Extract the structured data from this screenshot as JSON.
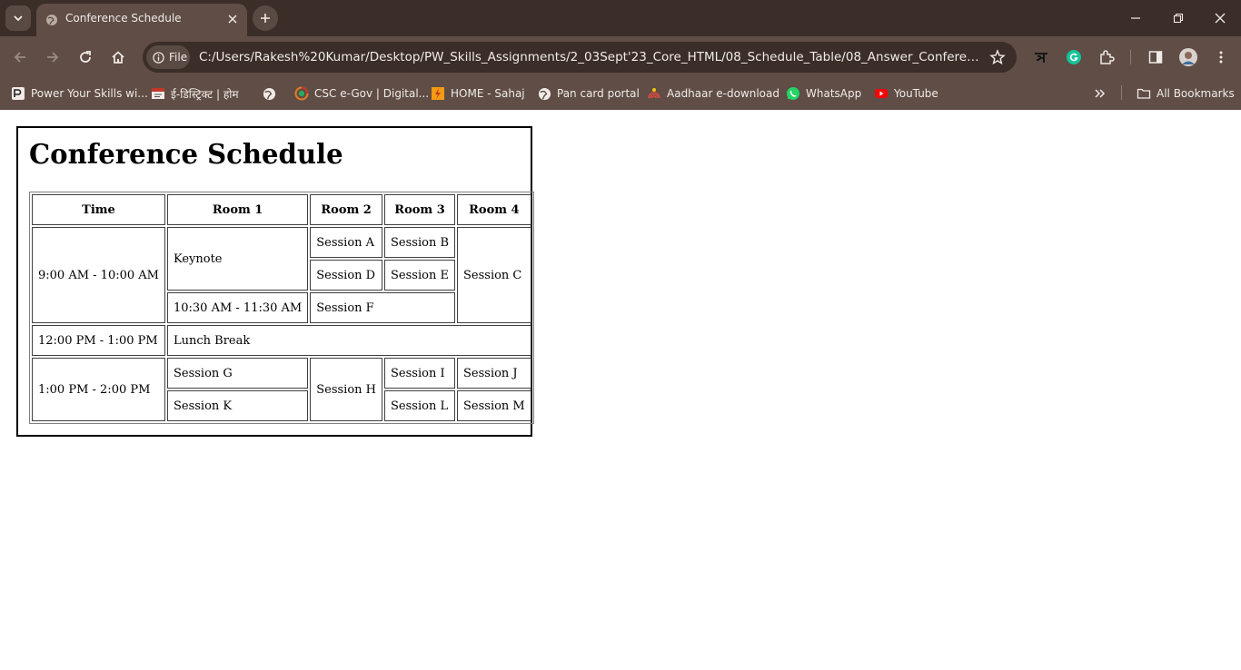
{
  "browser": {
    "tab": {
      "title": "Conference Schedule"
    },
    "omnibox": {
      "chip_label": "File",
      "url": "C:/Users/Rakesh%20Kumar/Desktop/PW_Skills_Assignments/2_03Sept'23_Core_HTML/08_Schedule_Table/08_Answer_Conference%20Schedule.html"
    },
    "bookmarks": [
      {
        "label": "Power Your Skills wi...",
        "icon": "pw-skills-icon"
      },
      {
        "label": "ई-डिस्ट्रिक्ट | होम",
        "icon": "e-district-icon"
      },
      {
        "label": "",
        "icon": "globe-icon"
      },
      {
        "label": "CSC e-Gov | Digital...",
        "icon": "csc-icon"
      },
      {
        "label": "HOME - Sahaj",
        "icon": "sahaj-icon"
      },
      {
        "label": "Pan card portal",
        "icon": "globe-icon"
      },
      {
        "label": "Aadhaar e-download",
        "icon": "aadhaar-icon"
      },
      {
        "label": "WhatsApp",
        "icon": "whatsapp-icon"
      },
      {
        "label": "YouTube",
        "icon": "youtube-icon"
      }
    ],
    "all_bookmarks_label": "All Bookmarks",
    "colors": {
      "frame": "#3b2d28",
      "toolbar": "#5f4d46",
      "text": "#f1ebe8"
    }
  },
  "page": {
    "heading": "Conference Schedule",
    "table": {
      "headers": [
        "Time",
        "Room 1",
        "Room 2",
        "Room 3",
        "Room 4"
      ],
      "slot1": {
        "time": "9:00 AM - 10:00 AM",
        "keynote": "Keynote",
        "session_a": "Session A",
        "session_b": "Session B",
        "session_c": "Session C",
        "session_d": "Session D",
        "session_e": "Session E",
        "time2": "10:30 AM - 11:30 AM",
        "session_f": "Session F"
      },
      "slot2": {
        "time": "12:00 PM - 1:00 PM",
        "lunch": "Lunch Break"
      },
      "slot3": {
        "time": "1:00 PM - 2:00 PM",
        "session_g": "Session G",
        "session_h": "Session H",
        "session_i": "Session I",
        "session_j": "Session J",
        "session_k": "Session K",
        "session_l": "Session L",
        "session_m": "Session M"
      }
    }
  }
}
